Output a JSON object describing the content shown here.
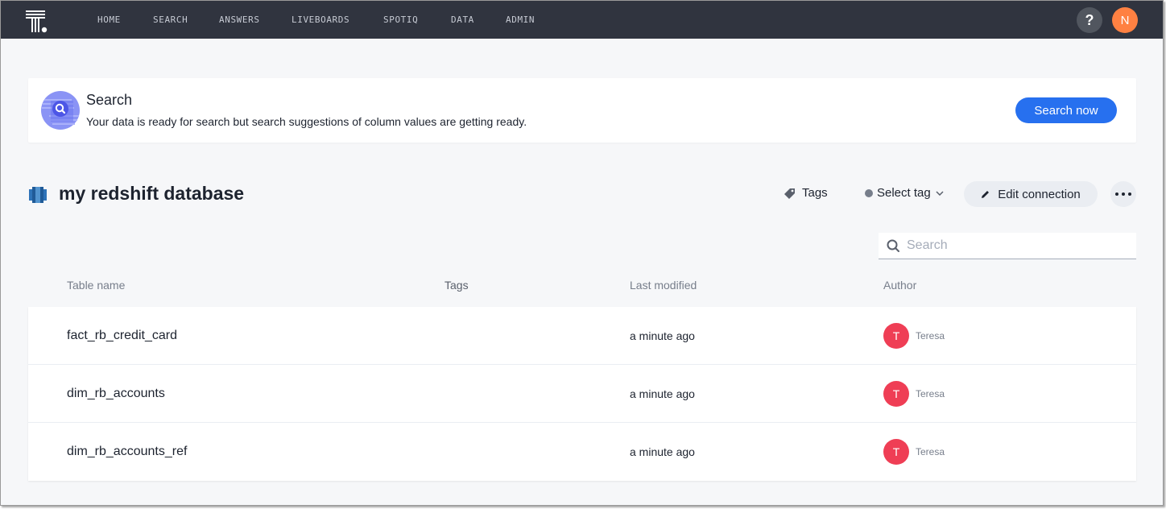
{
  "nav": {
    "items": [
      "HOME",
      "SEARCH",
      "ANSWERS",
      "LIVEBOARDS",
      "SPOTIQ",
      "DATA",
      "ADMIN"
    ],
    "help_label": "?",
    "user_initial": "N"
  },
  "banner": {
    "title": "Search",
    "description": "Your data is ready for search but search suggestions of column values are getting ready.",
    "button_label": "Search now"
  },
  "connection": {
    "title": "my redshift database",
    "tags_label": "Tags",
    "select_tag_label": "Select tag",
    "edit_label": "Edit connection"
  },
  "search": {
    "placeholder": "Search",
    "value": ""
  },
  "table": {
    "columns": [
      "Table name",
      "Tags",
      "Last modified",
      "Author"
    ],
    "rows": [
      {
        "name": "fact_rb_credit_card",
        "tags": "",
        "modified": "a minute ago",
        "author_initial": "T",
        "author": "Teresa"
      },
      {
        "name": "dim_rb_accounts",
        "tags": "",
        "modified": "a minute ago",
        "author_initial": "T",
        "author": "Teresa"
      },
      {
        "name": "dim_rb_accounts_ref",
        "tags": "",
        "modified": "a minute ago",
        "author_initial": "T",
        "author": "Teresa"
      }
    ]
  },
  "colors": {
    "nav_bg": "#30343f",
    "accent_blue": "#2770ef",
    "user_avatar": "#ff8142",
    "author_avatar": "#ef3e55"
  }
}
